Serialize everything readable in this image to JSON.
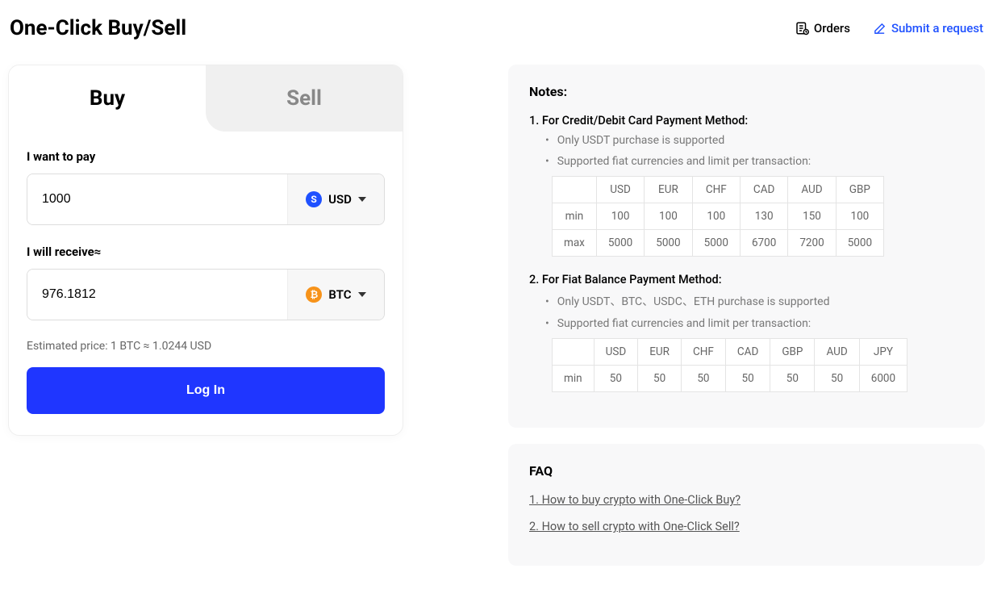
{
  "header": {
    "title": "One-Click Buy/Sell",
    "orders": "Orders",
    "submit": "Submit a request"
  },
  "tabs": {
    "buy": "Buy",
    "sell": "Sell"
  },
  "form": {
    "pay_label": "I want to pay",
    "pay_value": "1000",
    "pay_currency": "USD",
    "receive_label": "I will receive≈",
    "receive_value": "976.1812",
    "receive_currency": "BTC",
    "estimated": "Estimated price: 1 BTC ≈ 1.0244 USD",
    "login": "Log In"
  },
  "notes": {
    "title": "Notes:",
    "item1_head": "1. For Credit/Debit Card Payment Method:",
    "item1_sub1": "Only USDT purchase is supported",
    "item1_sub2": "Supported fiat currencies and limit per transaction:",
    "table1": {
      "headers": [
        "",
        "USD",
        "EUR",
        "CHF",
        "CAD",
        "AUD",
        "GBP"
      ],
      "rows": [
        [
          "min",
          "100",
          "100",
          "100",
          "130",
          "150",
          "100"
        ],
        [
          "max",
          "5000",
          "5000",
          "5000",
          "6700",
          "7200",
          "5000"
        ]
      ]
    },
    "item2_head": "2. For Fiat Balance Payment Method:",
    "item2_sub1": "Only USDT、BTC、USDC、ETH purchase is supported",
    "item2_sub2": "Supported fiat currencies and limit per transaction:",
    "table2": {
      "headers": [
        "",
        "USD",
        "EUR",
        "CHF",
        "CAD",
        "GBP",
        "AUD",
        "JPY"
      ],
      "rows": [
        [
          "min",
          "50",
          "50",
          "50",
          "50",
          "50",
          "50",
          "6000"
        ]
      ]
    }
  },
  "faq": {
    "title": "FAQ",
    "q1": "1. How to buy crypto with One-Click Buy?",
    "q2": "2. How to sell crypto with One-Click Sell?"
  }
}
